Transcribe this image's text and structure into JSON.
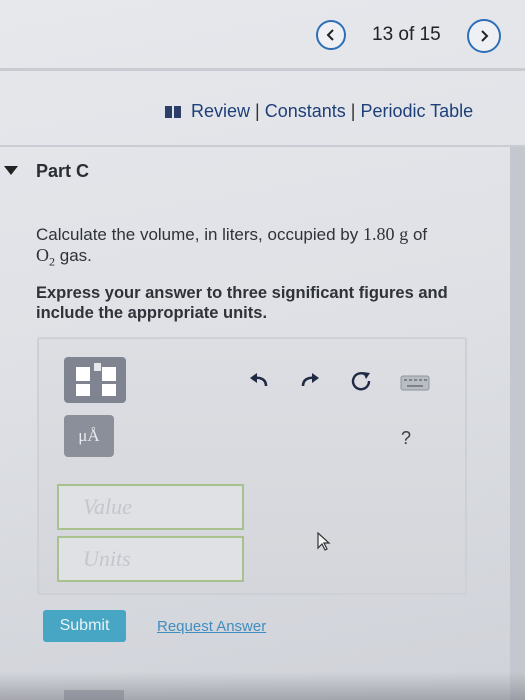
{
  "nav": {
    "counter": "13 of 15",
    "prev_icon": "chevron-left-icon",
    "next_icon": "chevron-right-icon"
  },
  "resources": {
    "icon": "book-icon",
    "review": "Review",
    "separator": "|",
    "constants": "Constants",
    "periodic_table": "Periodic Table"
  },
  "part": {
    "label": "Part C",
    "question_text": "Calculate the volume, in liters, occupied by",
    "mass": "1.80",
    "mass_unit": "g",
    "of_text": "of",
    "formula_main": "O",
    "formula_sub": "2",
    "gas_text": "gas.",
    "instruction": "Express your answer to three significant figures and include the appropriate units."
  },
  "answer": {
    "units_button_label": "μÅ",
    "help_label": "?",
    "value_placeholder": "Value",
    "units_placeholder": "Units",
    "submit_label": "Submit",
    "request_answer_label": "Request Answer"
  },
  "colors": {
    "nav_ring": "#2e6fb8",
    "submit_bg": "#46a6c4",
    "link": "#3f8ec0",
    "field_border": "#a7c28e"
  }
}
